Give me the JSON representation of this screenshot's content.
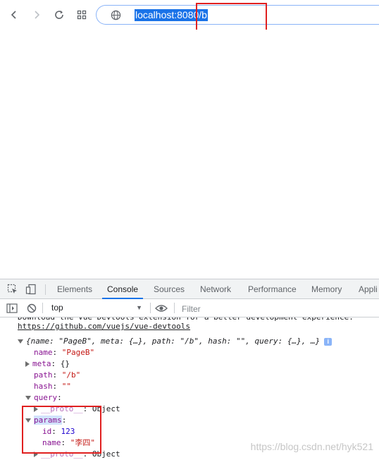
{
  "browser": {
    "url": "localhost:8080/b",
    "icons": [
      "back-arrow-icon",
      "forward-arrow-icon",
      "reload-icon",
      "apps-grid-icon",
      "globe-icon"
    ]
  },
  "devtools": {
    "tabs": [
      {
        "label": "Elements"
      },
      {
        "label": "Console",
        "active": true
      },
      {
        "label": "Sources"
      },
      {
        "label": "Network"
      },
      {
        "label": "Performance"
      },
      {
        "label": "Memory"
      },
      {
        "label": "Appli"
      }
    ],
    "context": "top",
    "filter_placeholder": "Filter"
  },
  "console": {
    "banner_text": "Download the Vue Devtools extension for a better development experience:",
    "banner_link": "https://github.com/vuejs/vue-devtools",
    "object_summary": "{name: \"PageB\", meta: {…}, path: \"/b\", hash: \"\", query: {…}, …}",
    "info_badge": "i",
    "name_key": "name",
    "name_value": "\"PageB\"",
    "meta_key": "meta",
    "meta_value": "{}",
    "path_key": "path",
    "path_value": "\"/b\"",
    "hash_key": "hash",
    "hash_value": "\"\"",
    "query_key": "query",
    "proto_key": "__proto__",
    "proto_value": "Object",
    "params_key": "params",
    "id_key": "id",
    "id_value": "123",
    "pname_key": "name",
    "pname_value": "\"李四\""
  },
  "watermark": "https://blog.csdn.net/hyk521",
  "colors": {
    "highlight_border": "#e02020",
    "url_selection": "#1a73e8",
    "active_tab_underline": "#1a73e8"
  }
}
